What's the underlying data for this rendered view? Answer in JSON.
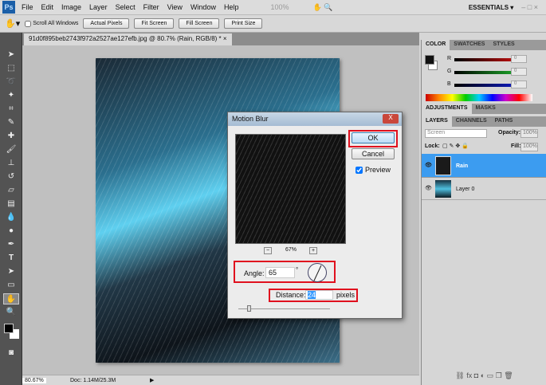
{
  "menubar": {
    "logo": "Ps",
    "items": [
      "File",
      "Edit",
      "Image",
      "Layer",
      "Select",
      "Filter",
      "View",
      "Window",
      "Help"
    ],
    "zoom": "100%",
    "workspace": "ESSENTIALS ▾"
  },
  "options": {
    "scroll_all": "Scroll All Windows",
    "buttons": [
      "Actual Pixels",
      "Fit Screen",
      "Fill Screen",
      "Print Size"
    ]
  },
  "document": {
    "tab": "91d0f895beb2743f972a2527ae127efb.jpg @ 80.7% (Rain, RGB/8) * ×",
    "zoom": "80.67%",
    "doc_info": "Doc: 1.14M/25.3M"
  },
  "color_panel": {
    "tabs": [
      "COLOR",
      "SWATCHES",
      "STYLES"
    ],
    "channels": [
      {
        "label": "R",
        "value": "0",
        "color": "#d01010"
      },
      {
        "label": "G",
        "value": "0",
        "color": "#10b020"
      },
      {
        "label": "B",
        "value": "0",
        "color": "#1020d0"
      }
    ]
  },
  "adjust_panel": {
    "tabs": [
      "ADJUSTMENTS",
      "MASKS"
    ]
  },
  "layers_panel": {
    "tabs": [
      "LAYERS",
      "CHANNELS",
      "PATHS"
    ],
    "blend": "Screen",
    "opacity_label": "Opacity:",
    "opacity": "100%",
    "lock_label": "Lock:",
    "fill_label": "Fill:",
    "fill": "100%",
    "layers": [
      {
        "name": "Rain",
        "selected": true
      },
      {
        "name": "Layer 0",
        "selected": false
      }
    ]
  },
  "dialog": {
    "title": "Motion Blur",
    "close": "X",
    "ok": "OK",
    "cancel": "Cancel",
    "preview_label": "Preview",
    "zoom": "67%",
    "minus": "−",
    "plus": "+",
    "angle_label": "Angle:",
    "angle": "65",
    "degree": "°",
    "distance_label": "Distance:",
    "distance": "24",
    "pixels": "pixels"
  }
}
